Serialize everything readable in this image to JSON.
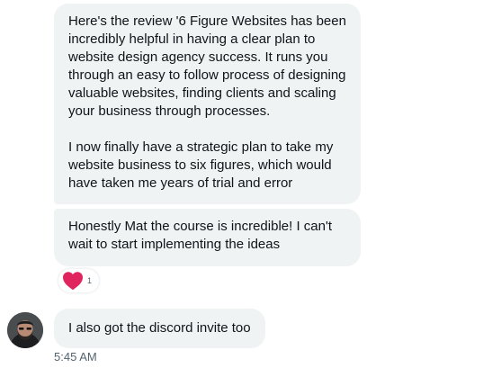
{
  "conversation": {
    "messages": [
      {
        "text": "Here's the review '6 Figure Websites has been incredibly helpful in having a clear plan to website design agency success. It runs you through an easy to follow process of designing valuable websites, finding clients and scaling your business through processes.\n\nI now finally have a strategic plan to take my website business to six figures, which would have taken me years of trial and error"
      },
      {
        "text": "Honestly Mat the course is incredible! I can't wait to start implementing the ideas",
        "reaction": {
          "icon": "heart-icon",
          "color": "#f91880",
          "count": "1"
        }
      },
      {
        "text": "I also got the discord invite too",
        "timestamp": "5:45 AM"
      }
    ],
    "colors": {
      "bubble_background": "#eff3f4",
      "text": "#0f1419",
      "secondary_text": "#536471"
    }
  }
}
